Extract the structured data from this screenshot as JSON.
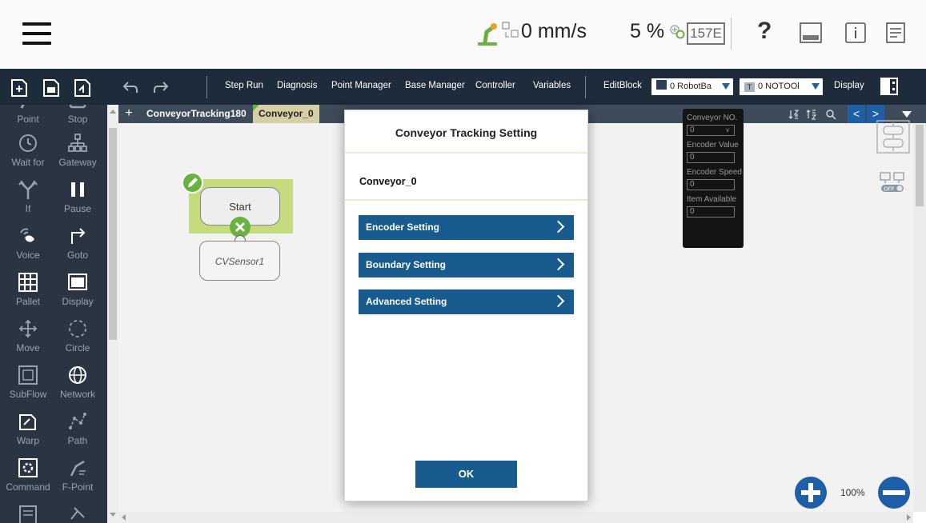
{
  "status_bar": {
    "speed": "0 mm/s",
    "speed_percent": "5 %",
    "code_box": "157E",
    "help": "?",
    "icons": [
      "menu-icon",
      "robot-arm-icon",
      "speed-sensor-icon",
      "payload-icon",
      "help-icon",
      "keyboard-icon",
      "info-icon",
      "log-icon"
    ]
  },
  "toolbar": {
    "items": [
      "Step Run",
      "Diagnosis",
      "Point Manager",
      "Base Manager",
      "Controller",
      "Variables",
      "EditBlock",
      "Display"
    ],
    "base_select": {
      "badge": "",
      "value": "0 RobotBa"
    },
    "tool_select": {
      "badge": "T",
      "value": "0 NOTOOl"
    }
  },
  "palette": {
    "items": [
      "Point",
      "Stop",
      "Wait for",
      "Gateway",
      "If",
      "Pause",
      "Voice",
      "Goto",
      "Pallet",
      "Display",
      "Move",
      "Circle",
      "SubFlow",
      "Network",
      "Warp",
      "Path",
      "Command",
      "F-Point"
    ]
  },
  "tabs": {
    "items": [
      "ConveyorTracking180",
      "Conveyor_0"
    ]
  },
  "flow": {
    "start_label": "Start",
    "cvsensor_label": "CVSensor1"
  },
  "conveyor_panel": {
    "conveyor_no_label": "Conveyor NO.",
    "conveyor_no_value": "0",
    "encoder_value_label": "Encoder Value",
    "encoder_value": "0",
    "encoder_speed_label": "Encoder Speed",
    "encoder_speed": "0",
    "item_available_label": "Item Available",
    "item_available": "0"
  },
  "zoom": {
    "level": "100%"
  },
  "modal": {
    "title": "Conveyor Tracking Setting",
    "subtitle": "Conveyor_0",
    "buttons": [
      "Encoder Setting",
      "Boundary Setting",
      "Advanced Setting"
    ],
    "ok_label": "OK"
  },
  "colors": {
    "toolbar_bg": "#1e2b3a",
    "palette_bg": "#2a3442",
    "accent_blue": "#185b8f",
    "node_green": "#6ab23e",
    "highlight": "#c6da7e"
  }
}
